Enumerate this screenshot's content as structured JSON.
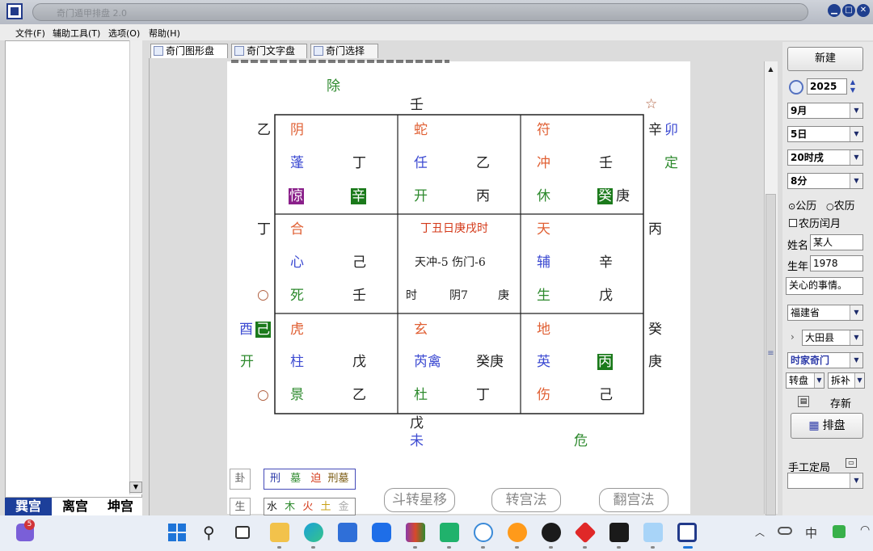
{
  "window": {
    "title": "奇门遁甲排盘 2.0"
  },
  "menu": [
    "文件(F)",
    "辅助工具(T)",
    "选项(O)",
    "帮助(H)"
  ],
  "tabs": [
    "奇门图形盘",
    "奇门文字盘",
    "奇门选择"
  ],
  "left_palaces": [
    "巽宫",
    "离宫",
    "坤宫"
  ],
  "chart": {
    "top_left_partial": "…",
    "outer": {
      "chu": "除",
      "ren_top": "壬",
      "star_mark": "☆",
      "yi_left": "乙",
      "xin_right": "辛",
      "mao": "卯",
      "ding_right": "定",
      "ding_left": "丁",
      "bing_right": "丙",
      "circle1": "○",
      "you": "酉",
      "ji_hl": "己",
      "gui_right": "癸",
      "kai_left": "开",
      "geng_right": "庚",
      "circle2": "○",
      "wu_bottom": "戊",
      "wei": "未",
      "wei2": "危"
    },
    "cells": {
      "xun": {
        "god": "阴",
        "star": "蓬",
        "stem_r1": "丁",
        "door": "惊",
        "stem_r2": "辛"
      },
      "li": {
        "god": "蛇",
        "star": "任",
        "stem_r1": "乙",
        "door": "开",
        "stem_r2": "丙"
      },
      "kun": {
        "god": "符",
        "star": "冲",
        "stem_r1": "壬",
        "door": "休",
        "stem_r2a": "癸",
        "stem_r2b": "庚"
      },
      "zhen": {
        "god": "合",
        "star": "心",
        "stem_r1": "己",
        "door": "死",
        "stem_r2": "壬"
      },
      "center": {
        "title": "丁丑日庚戌时",
        "line2": "天冲-5  伤门-6",
        "c1": "时",
        "c2": "阴7",
        "c3": "庚"
      },
      "dui": {
        "god": "天",
        "star": "辅",
        "stem_r1": "辛",
        "door": "生",
        "stem_r2": "戊"
      },
      "gen": {
        "god": "虎",
        "star": "柱",
        "stem_r1": "戊",
        "door": "景",
        "stem_r2": "乙"
      },
      "kan": {
        "god": "玄",
        "star": "芮禽",
        "stem_r1": "癸庚",
        "door": "杜",
        "stem_r2": "丁"
      },
      "qian": {
        "god": "地",
        "star": "英",
        "stem_r1": "丙",
        "door": "伤",
        "stem_r2": "己"
      }
    },
    "bottom": {
      "gua": "卦",
      "sheng": "生",
      "legend1": [
        "刑",
        "墓",
        "迫",
        "刑墓"
      ],
      "legend2": [
        "水",
        "木",
        "火",
        "土",
        "金"
      ],
      "btn1": "斗转星移",
      "btn2": "转宫法",
      "btn3": "翻宫法"
    }
  },
  "right": {
    "new_btn": "新建",
    "year": "2025",
    "month": "9月",
    "day": "5日",
    "hour": "20时戌",
    "minute": "8分",
    "cal_gongli": "公历",
    "cal_nongli": "农历",
    "leap": "农历闰月",
    "name_label": "姓名",
    "name_value": "某人",
    "year_label": "生年",
    "year_value": "1978",
    "concern": "关心的事情。",
    "province": "福建省",
    "county": "大田县",
    "method": "时家奇门",
    "pan": "转盘",
    "split": "拆补",
    "save": "存新",
    "paipan": "排盘",
    "manual": "手工定局"
  },
  "taskbar": {
    "badge": "5",
    "ime": "中"
  },
  "colors": {
    "accent": "#1f3f8f",
    "highlight_green": "#1b7a1b",
    "highlight_purple": "#8a1f8a"
  }
}
